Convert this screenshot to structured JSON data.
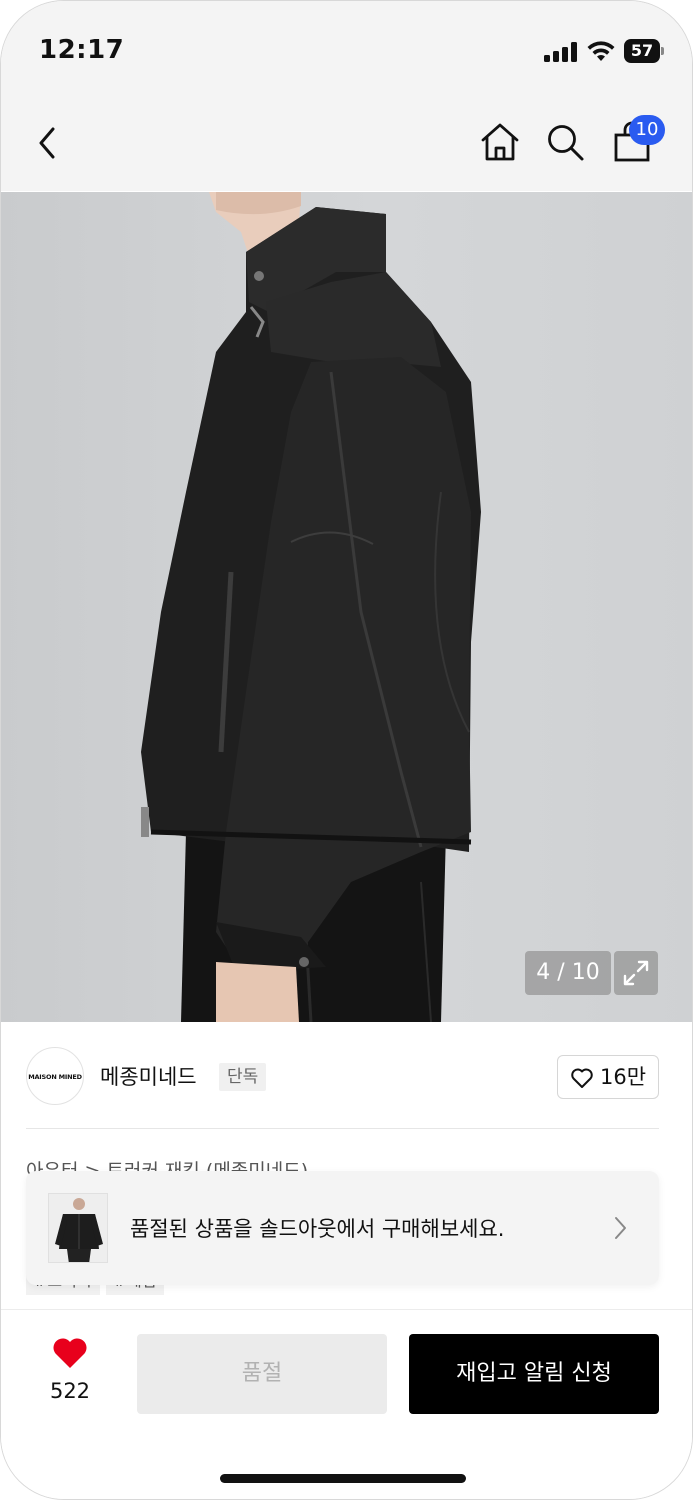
{
  "status_bar": {
    "time": "12:17",
    "battery": "57"
  },
  "nav": {
    "icons": [
      "back-icon",
      "home-icon",
      "search-icon",
      "bag-icon"
    ],
    "cart_badge": "10"
  },
  "gallery": {
    "counter": "4 / 10",
    "description": "black coated denim jacket, side view"
  },
  "brand": {
    "logo_text": "MAISON MINED",
    "name": "메종미네드",
    "tag": "단독",
    "likes": "16만"
  },
  "product": {
    "breadcrumb_partial": "아우터 > 트러커 재킷 (메종미네드)",
    "tags_partial": [
      "#트러커",
      "#데님"
    ]
  },
  "banner": {
    "text": "품절된 상품을 솔드아웃에서 구매해보세요."
  },
  "bottom_bar": {
    "wish_count": "522",
    "soldout_label": "품절",
    "restock_label": "재입고 알림 신청"
  },
  "colors": {
    "accent": "#2a5bf0",
    "heart": "#e8001c",
    "primary_button": "#000000",
    "disabled_button": "#ebebeb"
  }
}
